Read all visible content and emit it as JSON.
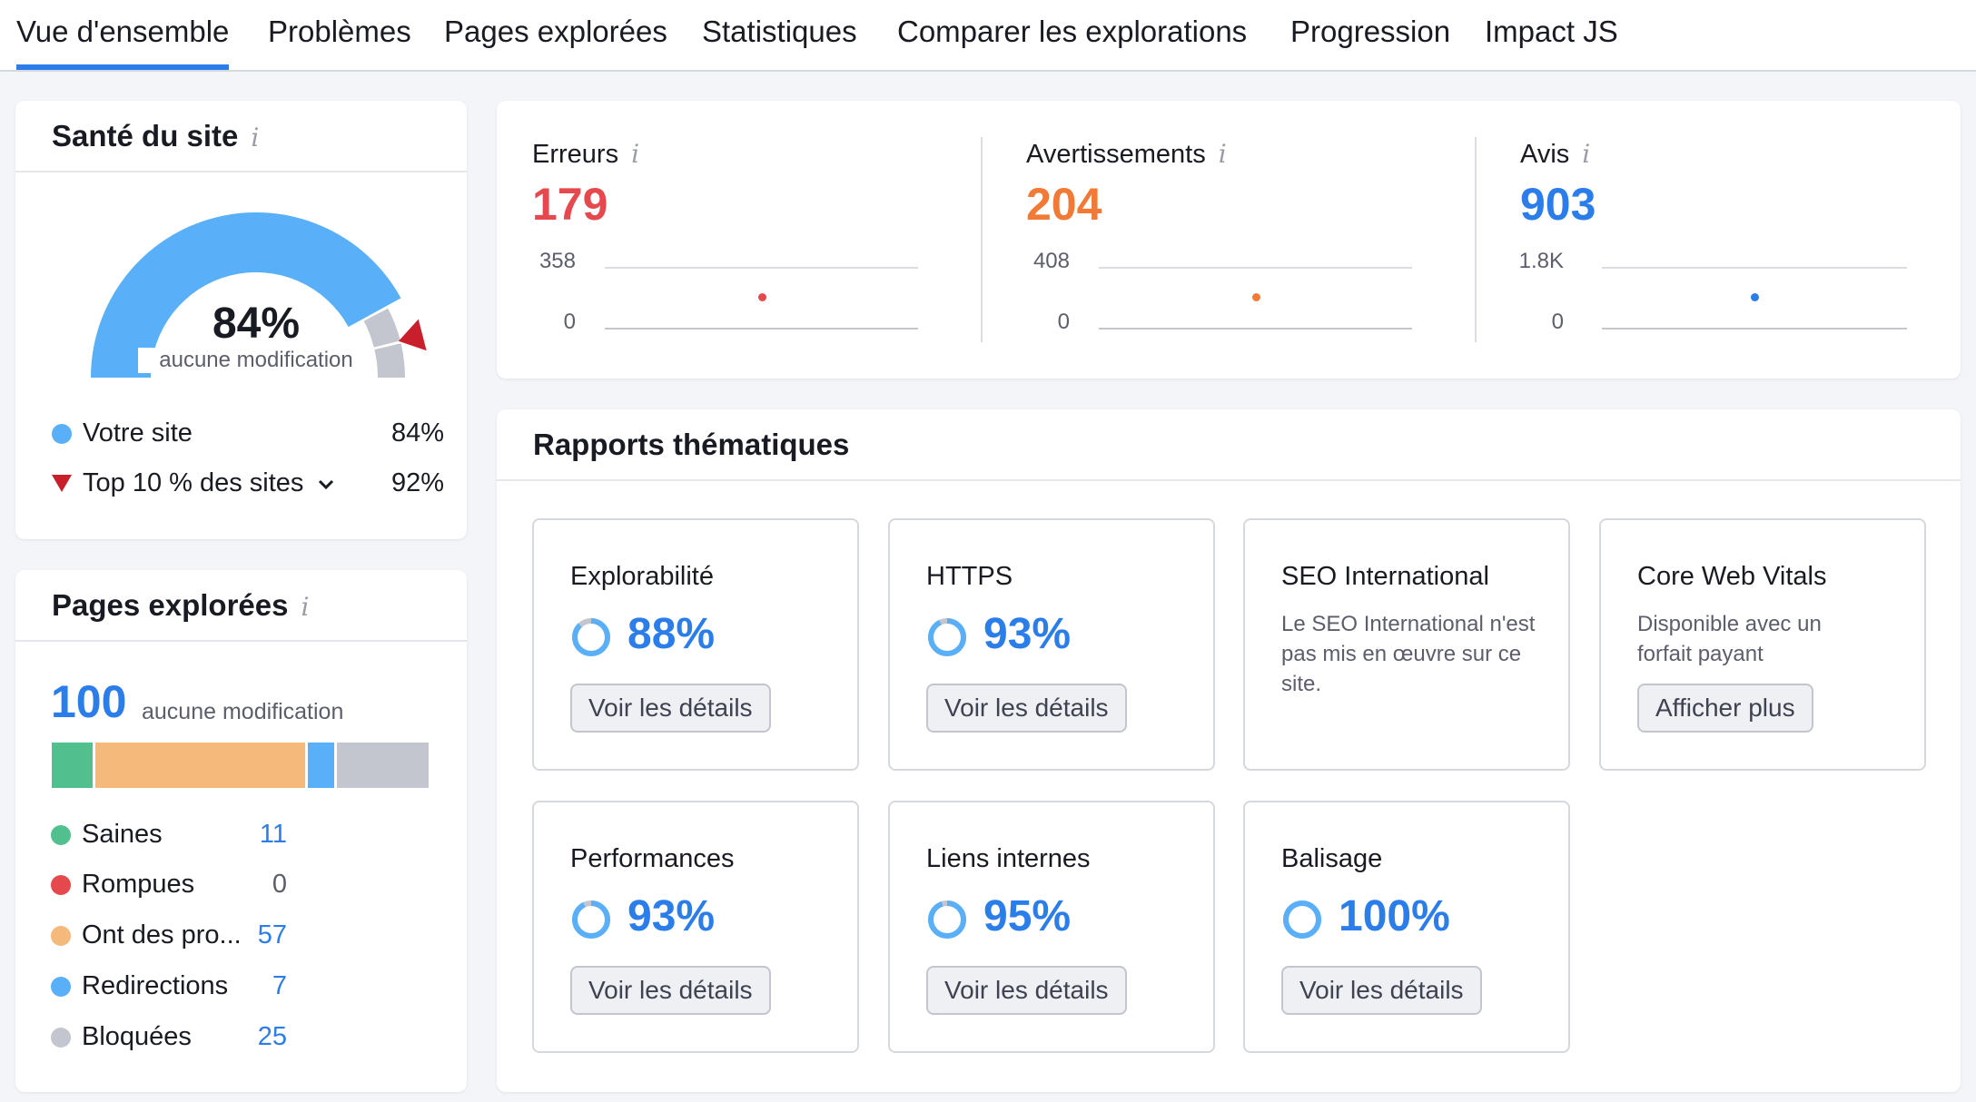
{
  "tabs": [
    {
      "label": "Vue d'ensemble",
      "active": true
    },
    {
      "label": "Problèmes"
    },
    {
      "label": "Pages explorées"
    },
    {
      "label": "Statistiques"
    },
    {
      "label": "Comparer les explorations"
    },
    {
      "label": "Progression"
    },
    {
      "label": "Impact JS"
    }
  ],
  "site_health": {
    "title": "Santé du site",
    "score": "84%",
    "score_value": 84,
    "top10_value": 92,
    "change": "aucune modification",
    "legend": [
      {
        "label": "Votre site",
        "value": "84%"
      },
      {
        "label": "Top 10 % des sites",
        "value": "92%"
      }
    ]
  },
  "crawled_pages": {
    "title": "Pages explorées",
    "count": "100",
    "change": "aucune modification",
    "items": [
      {
        "label": "Saines",
        "value": "11"
      },
      {
        "label": "Rompues",
        "value": "0"
      },
      {
        "label": "Ont des pro...",
        "value": "57"
      },
      {
        "label": "Redirections",
        "value": "7"
      },
      {
        "label": "Bloquées",
        "value": "25"
      }
    ]
  },
  "stats": [
    {
      "label": "Erreurs",
      "value": "179",
      "ymax": "358",
      "ymin": "0"
    },
    {
      "label": "Avertissements",
      "value": "204",
      "ymax": "408",
      "ymin": "0"
    },
    {
      "label": "Avis",
      "value": "903",
      "ymax": "1.8K",
      "ymin": "0"
    }
  ],
  "thematic": {
    "title": "Rapports thématiques",
    "cards": [
      {
        "name": "Explorabilité",
        "pct": "88%",
        "pct_value": 88,
        "button": "Voir les détails"
      },
      {
        "name": "HTTPS",
        "pct": "93%",
        "pct_value": 93,
        "button": "Voir les détails"
      },
      {
        "name": "SEO International",
        "desc": "Le SEO International n'est pas mis en œuvre sur ce site."
      },
      {
        "name": "Core Web Vitals",
        "desc": "Disponible avec un forfait payant",
        "button": "Afficher plus"
      },
      {
        "name": "Performances",
        "pct": "93%",
        "pct_value": 93,
        "button": "Voir les détails"
      },
      {
        "name": "Liens internes",
        "pct": "95%",
        "pct_value": 95,
        "button": "Voir les détails"
      },
      {
        "name": "Balisage",
        "pct": "100%",
        "pct_value": 100,
        "button": "Voir les détails"
      }
    ]
  },
  "colors": {
    "accent": "#2b7de9",
    "gauge_blue": "#5ab0f8",
    "gauge_gray": "#c4c6cf",
    "error": "#e5484d",
    "warning": "#f07a36",
    "notice": "#2b7de9",
    "healthy": "#52c08e",
    "broken": "#e5484d",
    "issues": "#f5b97b",
    "redirects": "#5ab0f8",
    "blocked": "#c4c6cf",
    "marker": "#c91f2d"
  },
  "icons": {
    "info": "info-icon",
    "chevron": "chevron-down-icon",
    "ring": "progress-ring-icon"
  }
}
